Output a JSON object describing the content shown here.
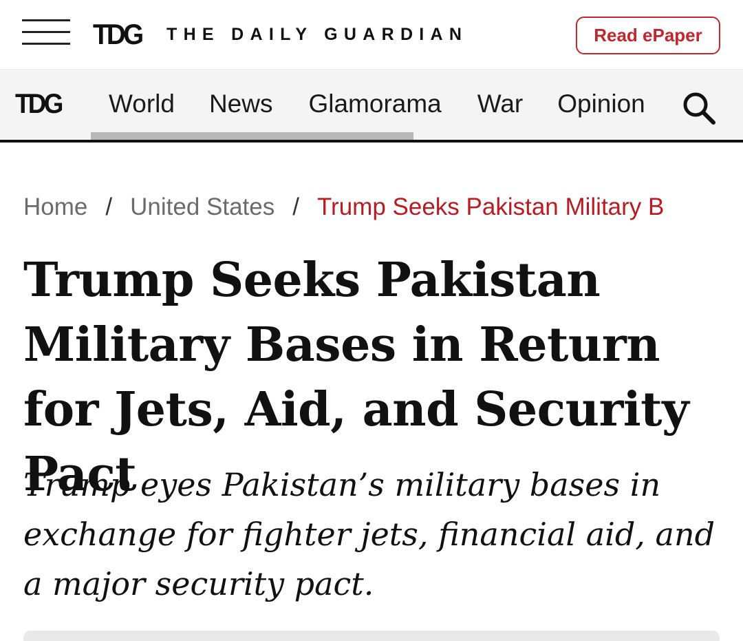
{
  "header": {
    "brand_mark": "TDG",
    "brand_name": "THE DAILY GUARDIAN",
    "epaper_label": "Read ePaper"
  },
  "nav": {
    "logo": "TDG",
    "items": [
      {
        "label": "World"
      },
      {
        "label": "News"
      },
      {
        "label": "Glamorama"
      },
      {
        "label": "War"
      },
      {
        "label": "Opinion"
      }
    ]
  },
  "breadcrumb": {
    "home": "Home",
    "separator": "/",
    "category": "United States",
    "current": "Trump Seeks Pakistan Military B"
  },
  "article": {
    "headline": "Trump Seeks Pakistan Military Bases in Return for Jets, Aid, and Security Pact",
    "subheadline": "Trump eyes Pakistan’s military bases in exchange for fighter jets, financial aid, and a major security pact."
  },
  "colors": {
    "accent_red": "#c1272d",
    "breadcrumb_current": "#b81c22",
    "nav_background": "#f4f4f4"
  }
}
